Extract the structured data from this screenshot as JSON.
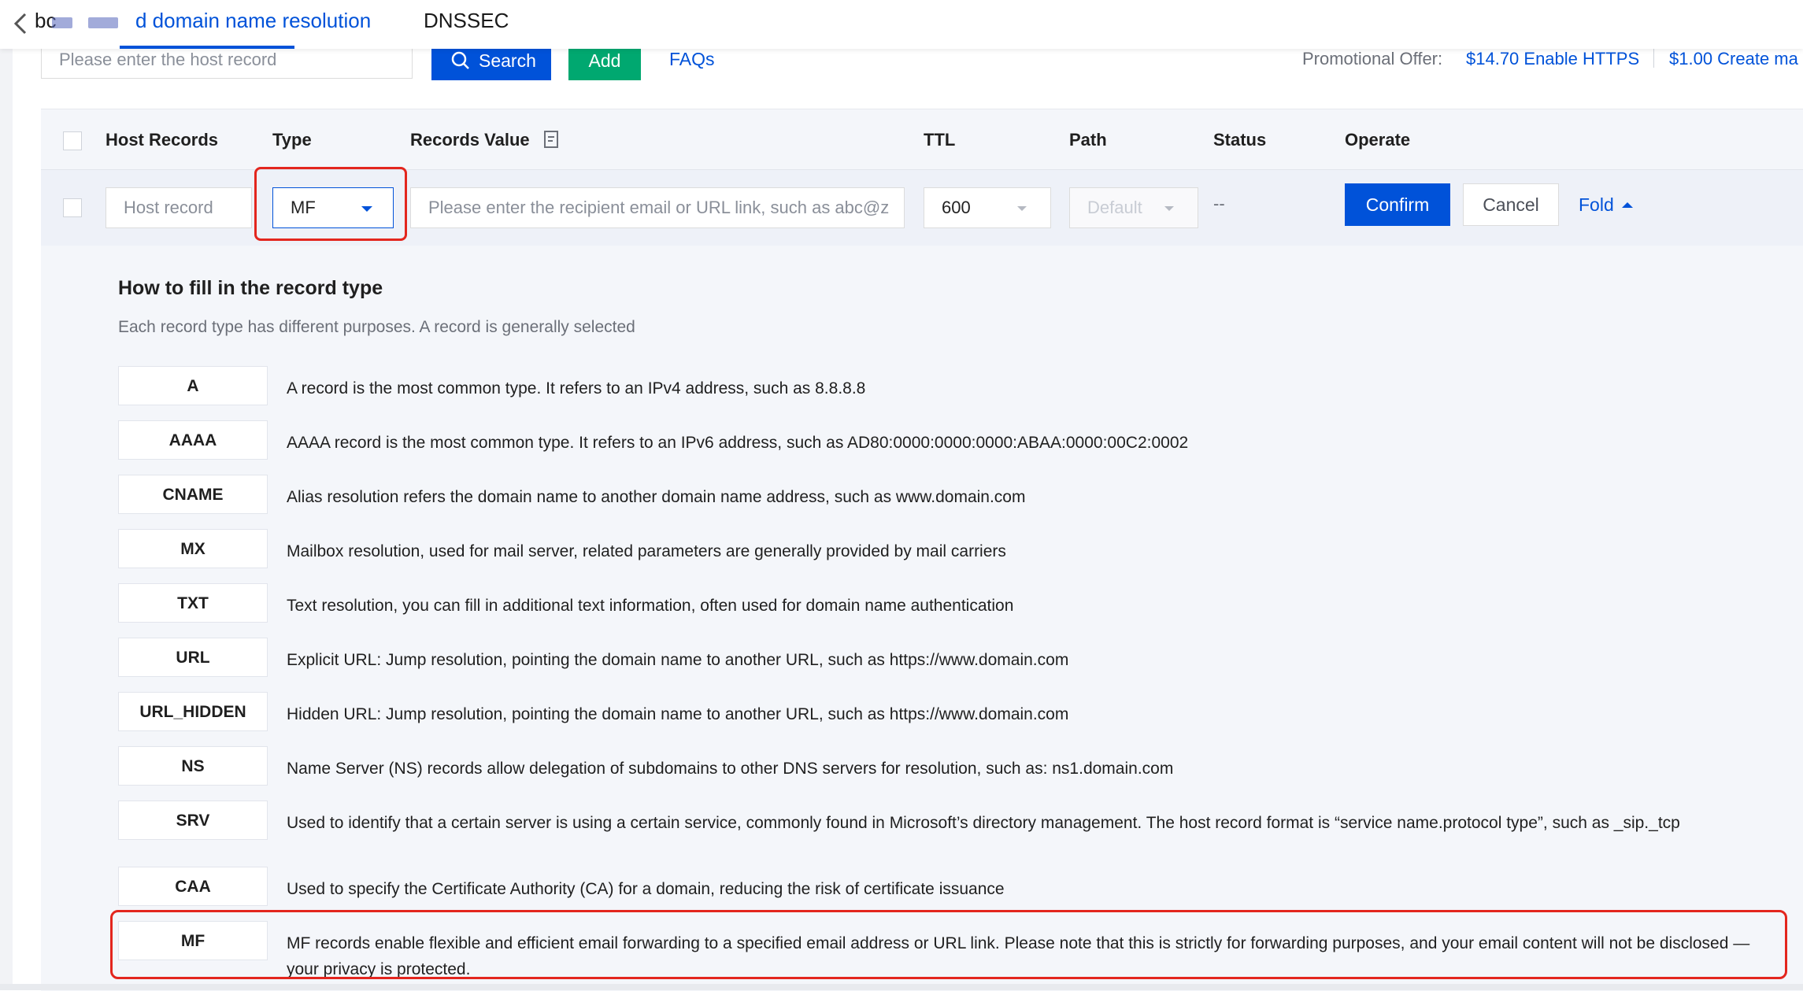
{
  "header": {
    "back_label": "bc",
    "tabs": [
      {
        "label": "d domain name resolution"
      },
      {
        "label": "DNSSEC"
      }
    ]
  },
  "toolbar": {
    "search_placeholder": "Please enter the host record",
    "search_label": "Search",
    "add_label": "Add",
    "faq_label": "FAQs",
    "promo_label": "Promotional Offer:",
    "promo_https": "$14.70 Enable HTTPS",
    "promo_mail": "$1.00 Create ma"
  },
  "table": {
    "columns": [
      "Host Records",
      "Type",
      "Records Value",
      "TTL",
      "Path",
      "Status",
      "Operate"
    ],
    "edit_row": {
      "host_placeholder": "Host record",
      "type_value": "MF",
      "value_placeholder": "Please enter the recipient email or URL link, such as abc@z",
      "ttl_value": "600",
      "path_value": "Default",
      "status_value": "--",
      "confirm_label": "Confirm",
      "cancel_label": "Cancel",
      "fold_label": "Fold"
    }
  },
  "help": {
    "title": "How to fill in the record type",
    "subtitle": "Each record type has different purposes. A record is generally selected",
    "types": [
      {
        "name": "A",
        "desc": "A record is the most common type. It refers to an IPv4 address, such as 8.8.8.8"
      },
      {
        "name": "AAAA",
        "desc": "AAAA record is the most common type. It refers to an IPv6 address, such as AD80:0000:0000:0000:ABAA:0000:00C2:0002"
      },
      {
        "name": "CNAME",
        "desc": "Alias resolution refers the domain name to another domain name address, such as www.domain.com"
      },
      {
        "name": "MX",
        "desc": "Mailbox resolution, used for mail server, related parameters are generally provided by mail carriers"
      },
      {
        "name": "TXT",
        "desc": "Text resolution, you can fill in additional text information, often used for domain name authentication"
      },
      {
        "name": "URL",
        "desc": "Explicit URL: Jump resolution, pointing the domain name to another URL, such as https://www.domain.com"
      },
      {
        "name": "URL_HIDDEN",
        "desc": "Hidden URL: Jump resolution, pointing the domain name to another URL, such as https://www.domain.com"
      },
      {
        "name": "NS",
        "desc": "Name Server (NS) records allow delegation of subdomains to other DNS servers for resolution, such as: ns1.domain.com"
      },
      {
        "name": "SRV",
        "desc": "Used to identify that a certain server is using a certain service, commonly found in Microsoft’s directory management. The host record format is “service name.protocol type”, such as _sip._tcp"
      },
      {
        "name": "CAA",
        "desc": "Used to specify the Certificate Authority (CA) for a domain, reducing the risk of certificate issuance"
      },
      {
        "name": "MF",
        "desc": "MF records enable flexible and efficient email forwarding to a specified email address or URL link. Please note that this is strictly for forwarding purposes, and your email content will not be disclosed — your privacy is protected."
      }
    ]
  },
  "colors": {
    "primary": "#0052d9",
    "add_green": "#00a870",
    "highlight_red": "#e3261e"
  }
}
